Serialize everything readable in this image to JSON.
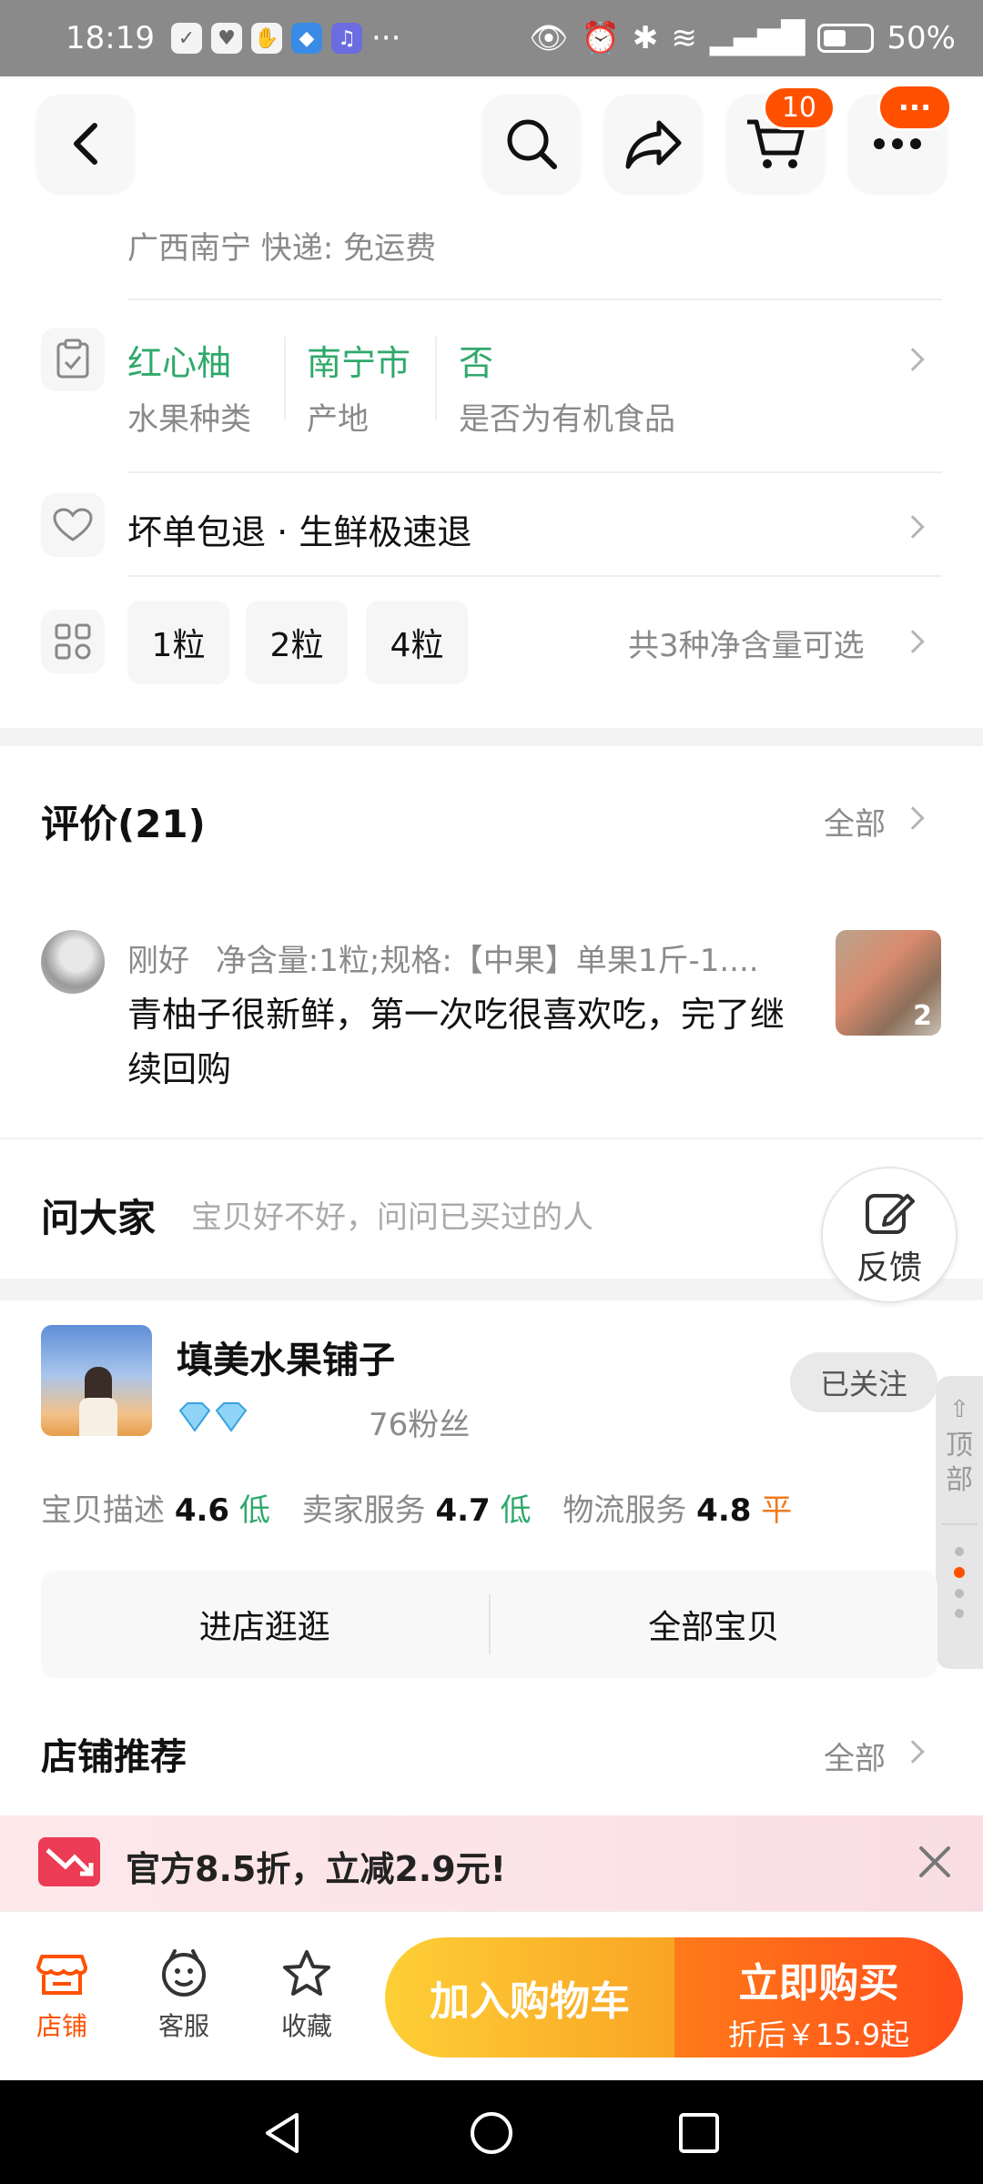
{
  "status_bar": {
    "time": "18:19",
    "battery": "50%"
  },
  "top_nav": {
    "cart_count": "10",
    "more_badge": "···"
  },
  "shipping": {
    "text": "广西南宁  快递: 免运费"
  },
  "attributes": [
    {
      "value": "红心柚",
      "label": "水果种类"
    },
    {
      "value": "南宁市",
      "label": "产地"
    },
    {
      "value": "否",
      "label": "是否为有机食品"
    }
  ],
  "guarantee": {
    "text": "坏单包退 · 生鲜极速退"
  },
  "variants": {
    "options": [
      "1粒",
      "2粒",
      "4粒"
    ],
    "summary": "共3种净含量可选"
  },
  "reviews": {
    "title": "评价(21)",
    "all_label": "全部",
    "item": {
      "user": "刚好",
      "spec": "净含量:1粒;规格:【中果】单果1斤-1....",
      "text": "青柚子很新鲜，第一次吃很喜欢吃，完了继续回购",
      "image_count": "2"
    }
  },
  "ask": {
    "title": "问大家",
    "hint": "宝贝好不好，问问已买过的人",
    "feedback_label": "反馈"
  },
  "shop": {
    "name": "填美水果铺子",
    "fans": "76粉丝",
    "follow_label": "已关注",
    "scores": [
      {
        "label": "宝贝描述",
        "value": "4.6",
        "level": "低"
      },
      {
        "label": "卖家服务",
        "value": "4.7",
        "level": "低"
      },
      {
        "label": "物流服务",
        "value": "4.8",
        "level": "平"
      }
    ],
    "enter_label": "进店逛逛",
    "all_items_label": "全部宝贝"
  },
  "side_float": {
    "label": "顶部"
  },
  "recommend": {
    "title": "店铺推荐",
    "all_label": "全部"
  },
  "promo": {
    "text": "官方8.5折，立减2.9元!"
  },
  "bottom_bar": {
    "tabs": [
      {
        "label": "店铺",
        "icon": "store-icon"
      },
      {
        "label": "客服",
        "icon": "service-icon"
      },
      {
        "label": "收藏",
        "icon": "star-icon"
      }
    ],
    "add_cart_label": "加入购物车",
    "buy_label": "立即购买",
    "buy_sub": "折后￥15.9起"
  },
  "colors": {
    "accent": "#ff5000",
    "green": "#2fa96b",
    "cart_btn": "#f9b62d",
    "buy_btn": "#ff5a17"
  }
}
